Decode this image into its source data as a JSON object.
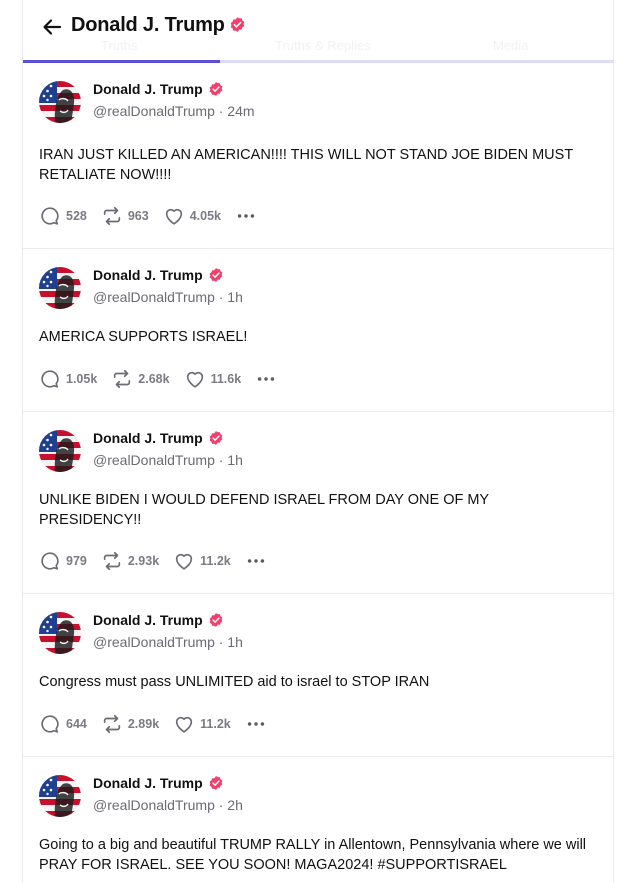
{
  "header": {
    "title": "Donald J. Trump",
    "tabs": [
      "Truths",
      "Truths & Replies",
      "Media"
    ]
  },
  "colors": {
    "verified": "#f0406b",
    "accent": "#5a4fd6",
    "muted": "#6b6b73"
  },
  "icons": {
    "back": "arrow-left-icon",
    "verified": "verified-badge-icon",
    "reply": "reply-icon",
    "retruth": "retruth-icon",
    "like": "heart-icon",
    "more": "more-icon"
  },
  "posts": [
    {
      "name": "Donald J. Trump",
      "handle": "@realDonaldTrump",
      "time": "· 24m",
      "text": "IRAN JUST KILLED AN AMERICAN!!!! THIS WILL NOT STAND JOE BIDEN MUST RETALIATE NOW!!!!",
      "replies": "528",
      "retruths": "963",
      "likes": "4.05k"
    },
    {
      "name": "Donald J. Trump",
      "handle": "@realDonaldTrump",
      "time": "· 1h",
      "text": "AMERICA SUPPORTS ISRAEL!",
      "replies": "1.05k",
      "retruths": "2.68k",
      "likes": "11.6k"
    },
    {
      "name": "Donald J. Trump",
      "handle": "@realDonaldTrump",
      "time": "· 1h",
      "text": "UNLIKE BIDEN I WOULD DEFEND ISRAEL FROM DAY ONE OF MY PRESIDENCY!!",
      "replies": "979",
      "retruths": "2.93k",
      "likes": "11.2k"
    },
    {
      "name": "Donald J. Trump",
      "handle": "@realDonaldTrump",
      "time": "· 1h",
      "text": "Congress must pass UNLIMITED aid to israel to STOP IRAN",
      "replies": "644",
      "retruths": "2.89k",
      "likes": "11.2k"
    },
    {
      "name": "Donald J. Trump",
      "handle": "@realDonaldTrump",
      "time": "· 2h",
      "text": "Going to a big and beautiful TRUMP RALLY in Allentown, Pennsylvania where we will PRAY FOR ISRAEL. SEE YOU SOON!  MAGA2024! #SUPPORTISRAEL"
    }
  ]
}
